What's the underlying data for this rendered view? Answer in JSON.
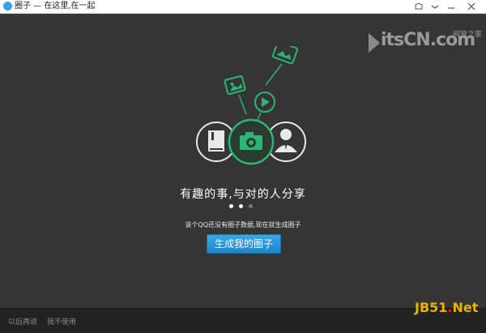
{
  "window": {
    "title": "圈子 — 在这里,在一起"
  },
  "watermark_top": {
    "brand": "itsCN.com",
    "sub": "网管之家"
  },
  "hero": {
    "tagline": "有趣的事,与对的人分享"
  },
  "pager": {
    "total": 3,
    "active": 2
  },
  "notice": "该个QQ还没有圈子数据,现在就生成圈子",
  "create_button": "生成我的圈子",
  "footer": {
    "later": "以后再说",
    "never": "我不使用"
  },
  "watermark_bottom": {
    "a": "JB51",
    "dot": ".",
    "b": "Net"
  },
  "colors": {
    "accent": "#2bb673",
    "button": "#2392d6",
    "bg": "#353535"
  }
}
